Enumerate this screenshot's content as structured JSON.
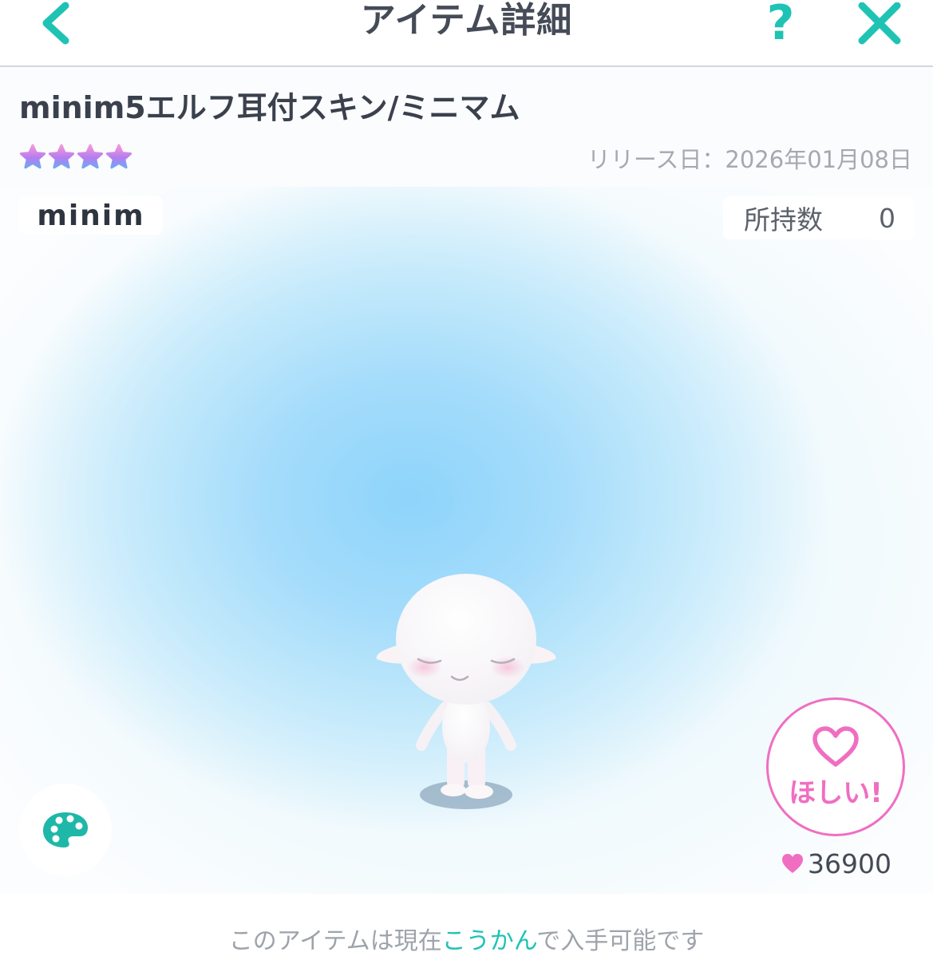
{
  "header": {
    "title": "アイテム詳細",
    "back_icon": "chevron-left-icon",
    "help_label": "?",
    "close_icon": "close-icon",
    "accent_color": "#1fc3b4"
  },
  "item": {
    "name": "minim5エルフ耳付スキン/ミニマム",
    "rarity_stars": 4,
    "release_label": "リリース日：2026年01月08日"
  },
  "stage": {
    "brand_badge": "minim",
    "owned_label": "所持数",
    "owned_count": "0",
    "palette_icon": "palette-icon",
    "wish_button_label": "ほしい!",
    "wish_icon": "heart-outline-icon",
    "wish_count": "36900",
    "wish_count_icon": "heart-icon",
    "wish_color": "#f06ec1"
  },
  "footer": {
    "message_prefix": "このアイテムは現在",
    "message_highlight": "こうかん",
    "message_suffix": "で入手可能です"
  }
}
